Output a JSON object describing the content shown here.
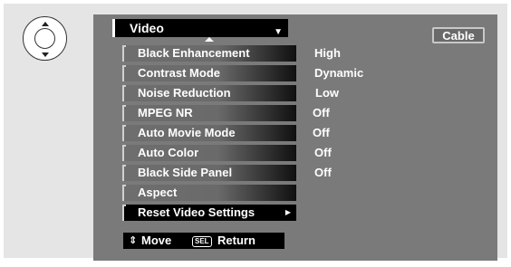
{
  "menu": {
    "title": "Video",
    "source": "Cable",
    "items": [
      {
        "label": "Black Enhancement",
        "value": "High"
      },
      {
        "label": "Contrast Mode",
        "value": "Dynamic"
      },
      {
        "label": "Noise Reduction",
        "value": "Low"
      },
      {
        "label": "MPEG NR",
        "value": "Off"
      },
      {
        "label": "Auto Movie Mode",
        "value": "Off"
      },
      {
        "label": "Auto Color",
        "value": "Off"
      },
      {
        "label": "Black Side Panel",
        "value": "Off"
      },
      {
        "label": "Aspect",
        "value": ""
      },
      {
        "label": "Reset Video Settings",
        "value": ""
      }
    ]
  },
  "help": {
    "move_label": "Move",
    "sel_key": "SEL",
    "return_label": "Return"
  },
  "icons": {
    "dpad": "remote-dpad-icon",
    "dropdown": "triangle-down-icon",
    "submenu": "triangle-right-icon"
  }
}
